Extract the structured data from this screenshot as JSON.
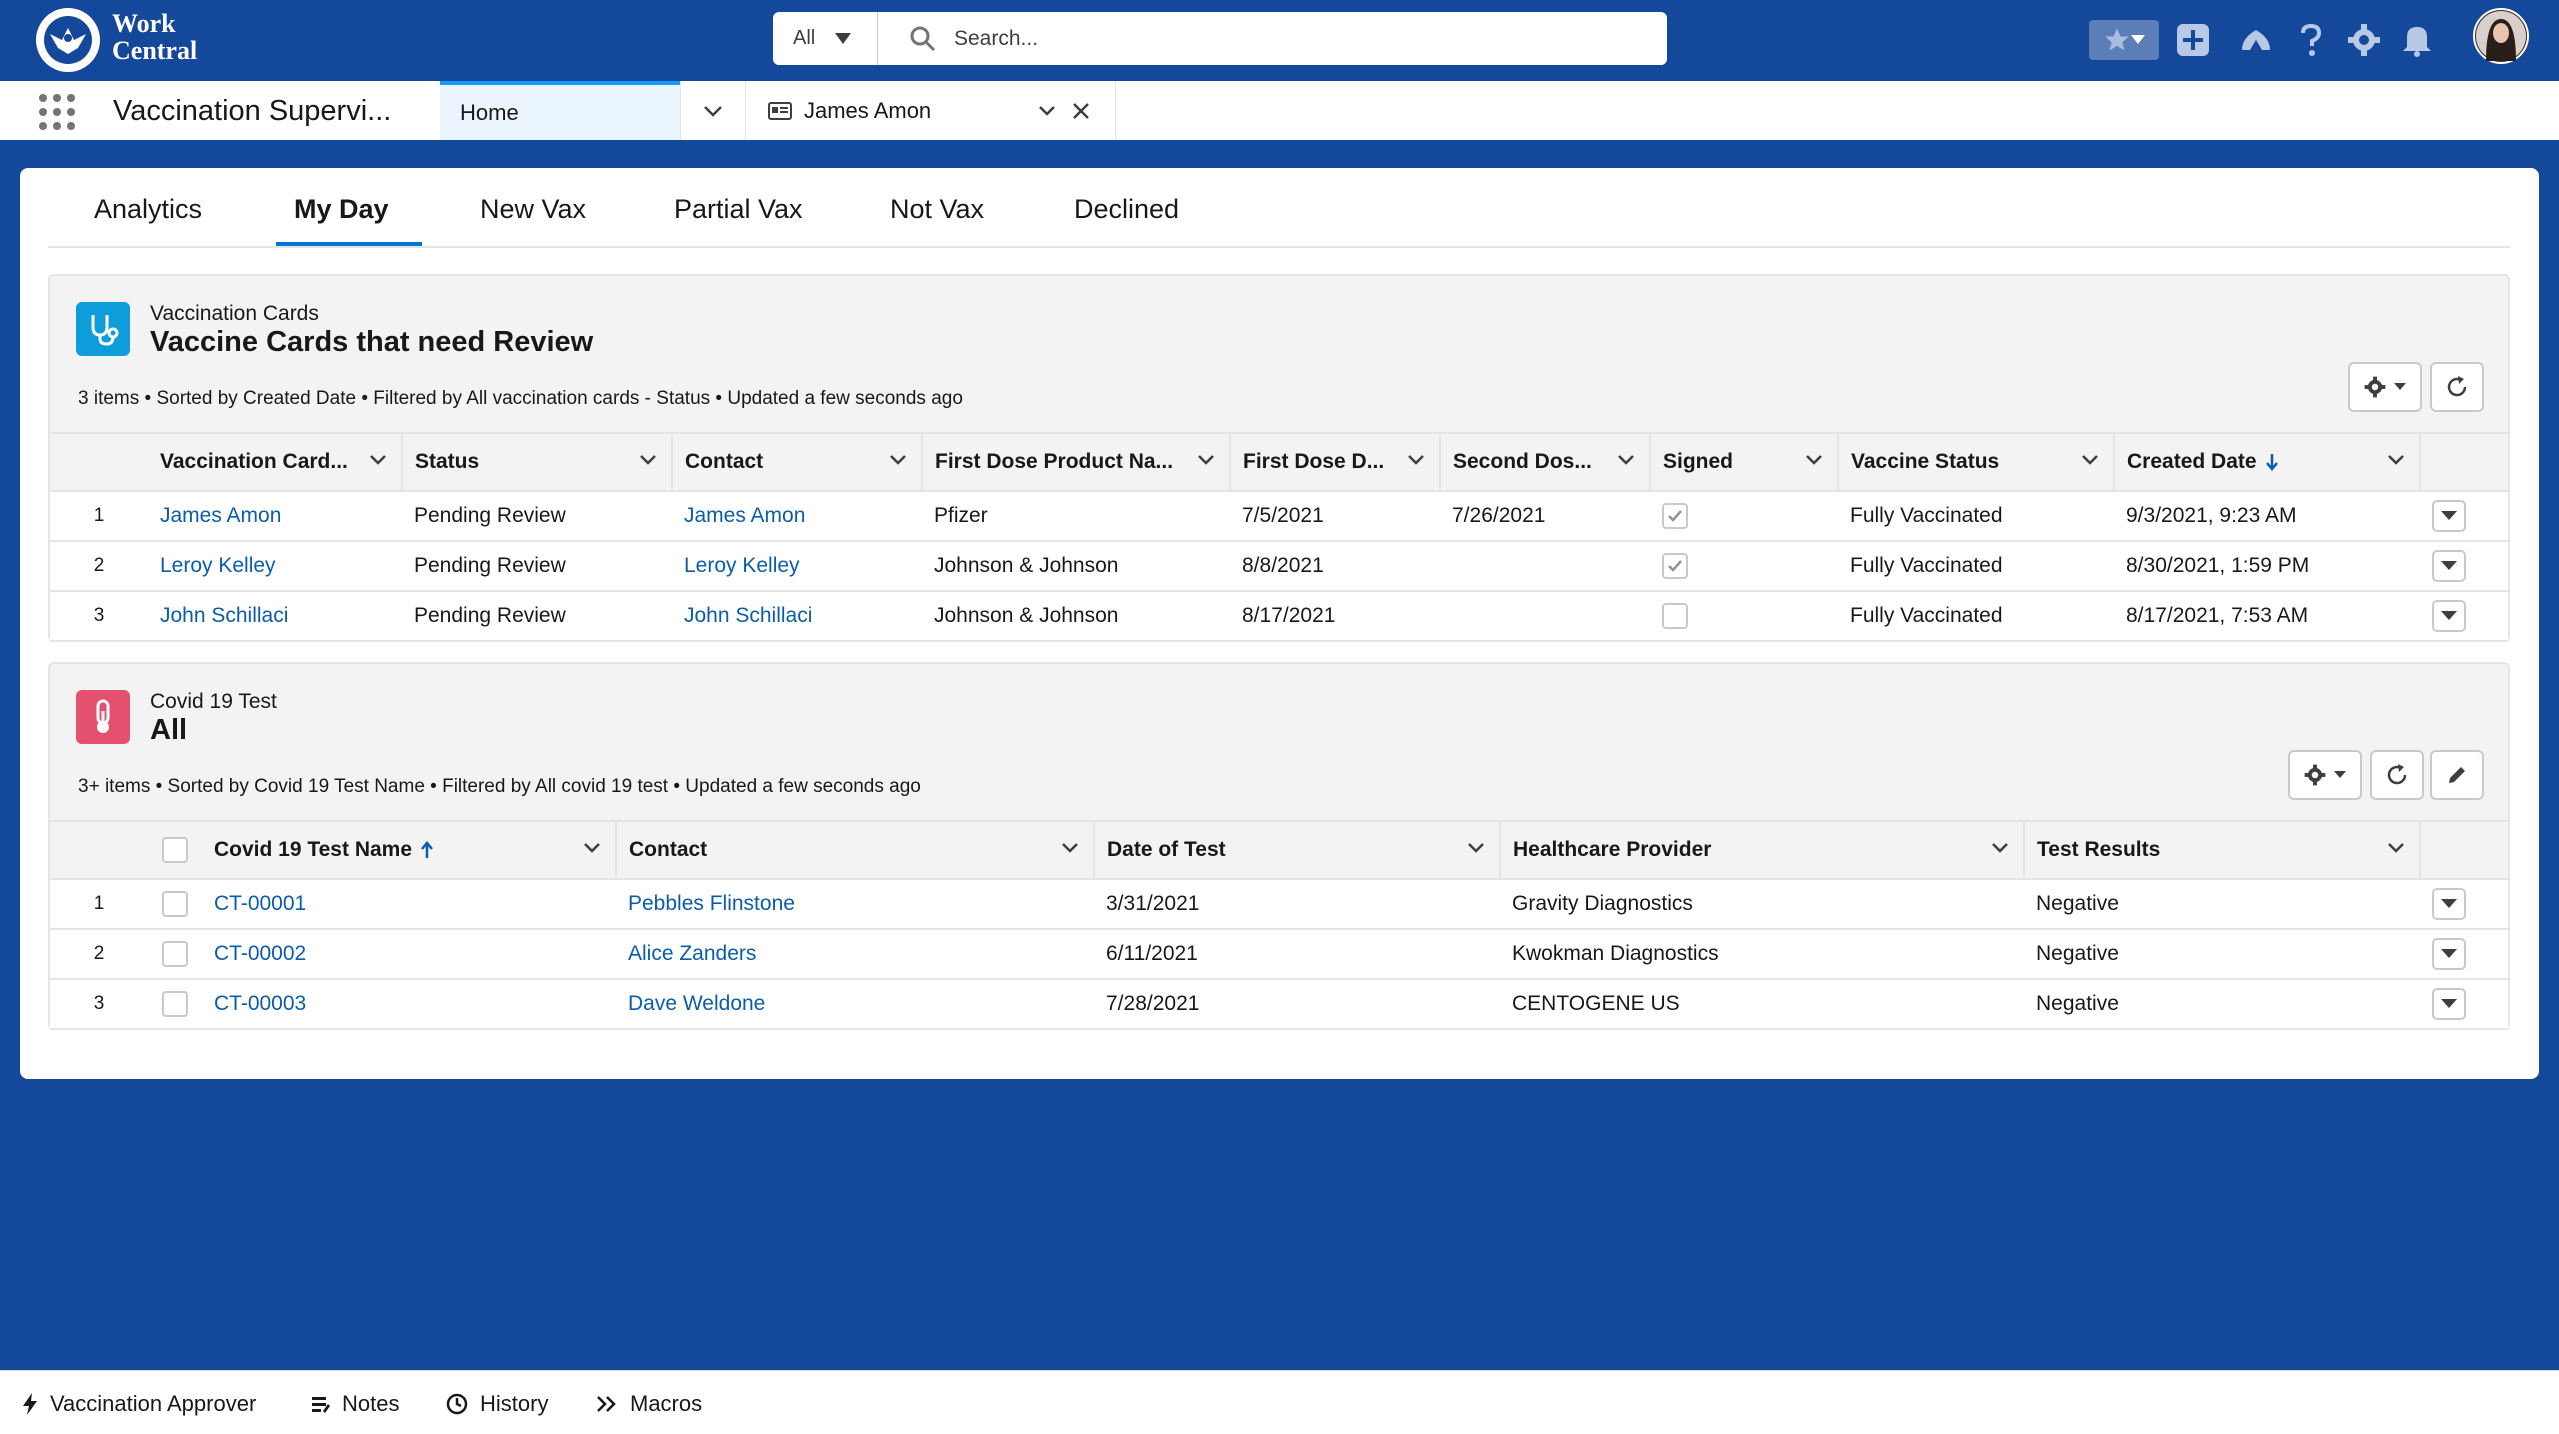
{
  "header": {
    "logo_line1": "Work",
    "logo_line2": "Central",
    "search_scope": "All",
    "search_placeholder": "Search..."
  },
  "nav": {
    "app_name": "Vaccination Supervi...",
    "tabs": [
      {
        "label": "Home",
        "active": true
      },
      {
        "label": "James Amon",
        "active": false
      }
    ]
  },
  "sub_tabs": [
    "Analytics",
    "My Day",
    "New Vax",
    "Partial Vax",
    "Not Vax",
    "Declined"
  ],
  "sub_tab_active": "My Day",
  "vaccination_cards": {
    "object_name": "Vaccination Cards",
    "title": "Vaccine Cards that need Review",
    "meta": "3 items • Sorted by Created Date • Filtered by All vaccination cards - Status • Updated a few seconds ago",
    "columns": [
      "Vaccination Card...",
      "Status",
      "Contact",
      "First Dose Product Na...",
      "First Dose D...",
      "Second Dos...",
      "Signed",
      "Vaccine Status",
      "Created Date"
    ],
    "rows": [
      {
        "num": "1",
        "card": "James Amon",
        "status": "Pending Review",
        "contact": "James Amon",
        "product": "Pfizer",
        "first_dose": "7/5/2021",
        "second_dose": "7/26/2021",
        "signed": true,
        "vaccine_status": "Fully Vaccinated",
        "created": "9/3/2021, 9:23 AM"
      },
      {
        "num": "2",
        "card": "Leroy Kelley",
        "status": "Pending Review",
        "contact": "Leroy Kelley",
        "product": "Johnson & Johnson",
        "first_dose": "8/8/2021",
        "second_dose": "",
        "signed": true,
        "vaccine_status": "Fully Vaccinated",
        "created": "8/30/2021, 1:59 PM"
      },
      {
        "num": "3",
        "card": "John Schillaci",
        "status": "Pending Review",
        "contact": "John Schillaci",
        "product": "Johnson & Johnson",
        "first_dose": "8/17/2021",
        "second_dose": "",
        "signed": false,
        "vaccine_status": "Fully Vaccinated",
        "created": "8/17/2021, 7:53 AM"
      }
    ]
  },
  "covid_tests": {
    "object_name": "Covid 19 Test",
    "title": "All",
    "meta": "3+ items • Sorted by Covid 19 Test Name • Filtered by All covid 19 test • Updated a few seconds ago",
    "columns": [
      "Covid 19 Test Name",
      "Contact",
      "Date of Test",
      "Healthcare Provider",
      "Test Results"
    ],
    "rows": [
      {
        "num": "1",
        "name": "CT-00001",
        "contact": "Pebbles Flinstone",
        "date": "3/31/2021",
        "provider": "Gravity Diagnostics",
        "result": "Negative"
      },
      {
        "num": "2",
        "name": "CT-00002",
        "contact": "Alice Zanders",
        "date": "6/11/2021",
        "provider": "Kwokman Diagnostics",
        "result": "Negative"
      },
      {
        "num": "3",
        "name": "CT-00003",
        "contact": "Dave Weldone",
        "date": "7/28/2021",
        "provider": "CENTOGENE US",
        "result": "Negative"
      }
    ]
  },
  "utility_bar": [
    "Vaccination Approver",
    "Notes",
    "History",
    "Macros"
  ],
  "colors": {
    "brand": "#14489a",
    "link": "#0b5cab",
    "vax_icon": "#0d9dda",
    "covid_icon": "#e3516f"
  }
}
